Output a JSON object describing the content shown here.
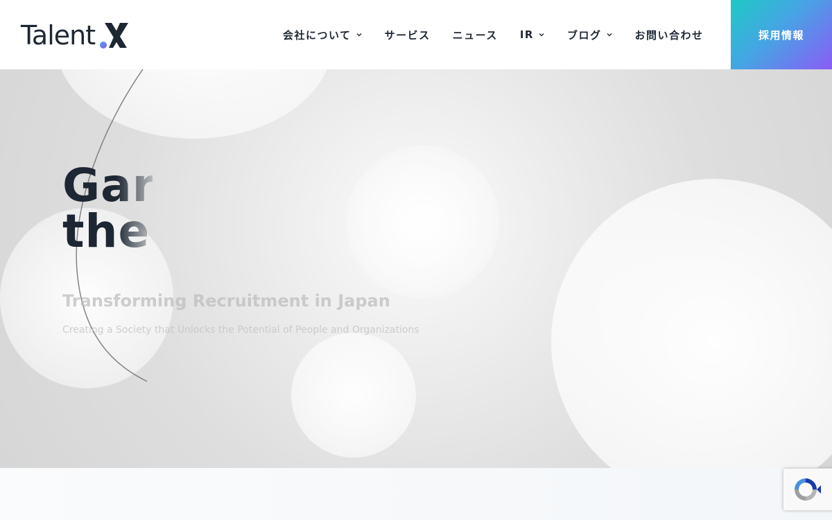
{
  "header": {
    "logo": {
      "text": "Talent",
      "mark_icon": "x-logo-icon",
      "mark_colors": [
        "#1d2733",
        "#46a4e4",
        "#8a5cf6"
      ]
    },
    "nav": [
      {
        "label": "会社について",
        "has_dropdown": true
      },
      {
        "label": "サービス",
        "has_dropdown": false
      },
      {
        "label": "ニュース",
        "has_dropdown": false
      },
      {
        "label": "IR",
        "has_dropdown": true
      },
      {
        "label": "ブログ",
        "has_dropdown": true
      },
      {
        "label": "お問い合わせ",
        "has_dropdown": false
      }
    ],
    "cta": {
      "label": "採用情報",
      "gradient": [
        "#1ec9c7",
        "#46a4e4",
        "#8a5cf6"
      ]
    }
  },
  "hero": {
    "title_lines": [
      "Gar",
      "the"
    ],
    "subtitle": "Transforming Recruitment in Japan",
    "description": "Creating a Society that Unlocks the Potential of People and Organizations"
  },
  "widgets": {
    "recaptcha_icon": "recaptcha-icon"
  },
  "colors": {
    "text_dark": "#1d2733",
    "hero_bg": "#dedede"
  }
}
